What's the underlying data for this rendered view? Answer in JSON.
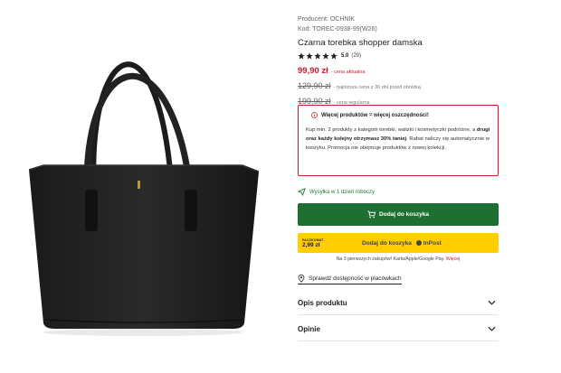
{
  "product": {
    "producer_label": "Producent:",
    "producer_name": "OCHNIK",
    "code": "Kod: TOREC-0938-99(W26)",
    "title": "Czarna torebka shopper damska",
    "rating_value": "5.0",
    "rating_count": "(29)",
    "stars": 5,
    "price_current": "99,90 zł",
    "price_current_label": "- cena aktualna",
    "price_lowest": "129,90 zł",
    "price_lowest_label": "- najniższa cena z 30 dni przed obniżką",
    "price_regular": "199,90 zł",
    "price_regular_label": "- cena regularna"
  },
  "promo": {
    "heading": "Więcej produktów = więcej oszczędności!",
    "text_part1": "Kup min. 2 produkty z kategorii torebki, walizki i kosmetyczki podróżne, a ",
    "text_bold": "drugi oraz każdy kolejny otrzymasz 30% taniej",
    "text_part2": ". Rabat naliczy się automatycznie w koszyku. Promocja nie obejmuje produktów z nowej kolekcji."
  },
  "delivery": {
    "text": "Wysyłka w 1 dzień roboczy"
  },
  "actions": {
    "add_to_cart": "Dodaj do koszyka",
    "inpost_tag_top": "PACZKOMAT",
    "inpost_tag_price": "2,99 zł",
    "inpost_label": "Dodaj do koszyka",
    "inpost_logo": "InPost",
    "pay_note": "Na 3 pierwszych zakupów! Karta/Apple/Google Pay.",
    "pay_note_link": "Więcej",
    "store_check": "Sprawdź dostępność w placówkach"
  },
  "accordions": [
    {
      "label": "Opis produktu"
    },
    {
      "label": "Opinie"
    }
  ],
  "colors": {
    "accent_red": "#d4172a",
    "cart_green": "#1e6f32",
    "inpost_yellow": "#ffcd00"
  }
}
